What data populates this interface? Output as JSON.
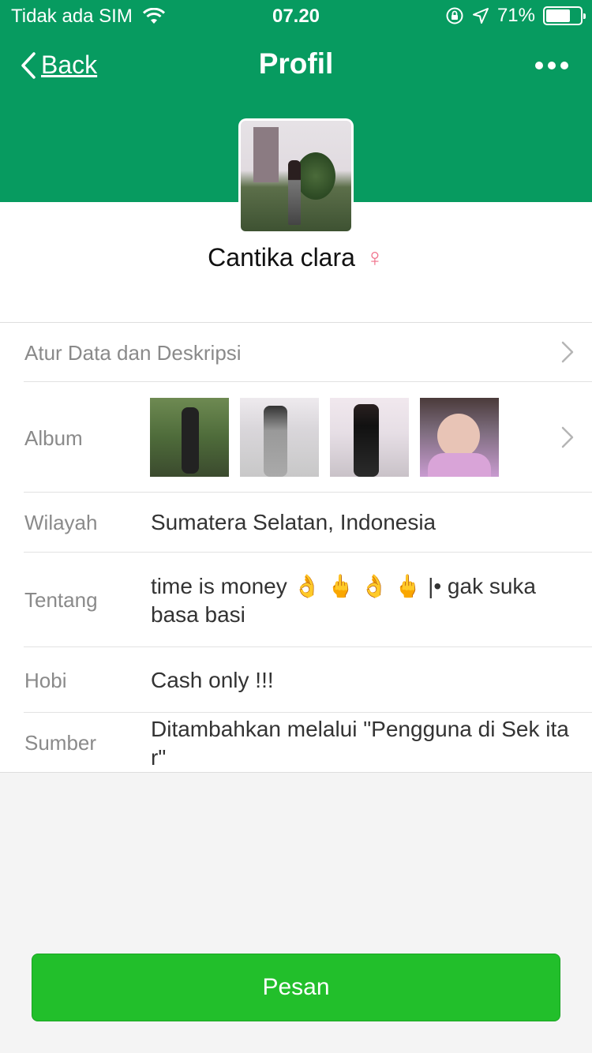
{
  "status_bar": {
    "carrier": "Tidak ada SIM",
    "time": "07.20",
    "battery": "71%",
    "battery_level": 0.71
  },
  "nav": {
    "back_label": "Back",
    "title": "Profil"
  },
  "profile": {
    "name": "Cantika clara",
    "gender_symbol": "♀"
  },
  "rows": {
    "settings_label": "Atur Data dan Deskripsi",
    "album_label": "Album",
    "region_label": "Wilayah",
    "region_value": "Sumatera Selatan, Indonesia",
    "about_label": "Tentang",
    "about_value": "time is money 👌 🖕 👌 🖕 |• gak suka basa basi",
    "hobby_label": "Hobi",
    "hobby_value": "Cash only !!!",
    "source_label": "Sumber",
    "source_value": "Ditambahkan melalui \"Pengguna di Sek itar\""
  },
  "actions": {
    "message_button": "Pesan"
  },
  "colors": {
    "header_green": "#079b60",
    "button_green": "#22bf2b",
    "gender_pink": "#f0708a"
  }
}
